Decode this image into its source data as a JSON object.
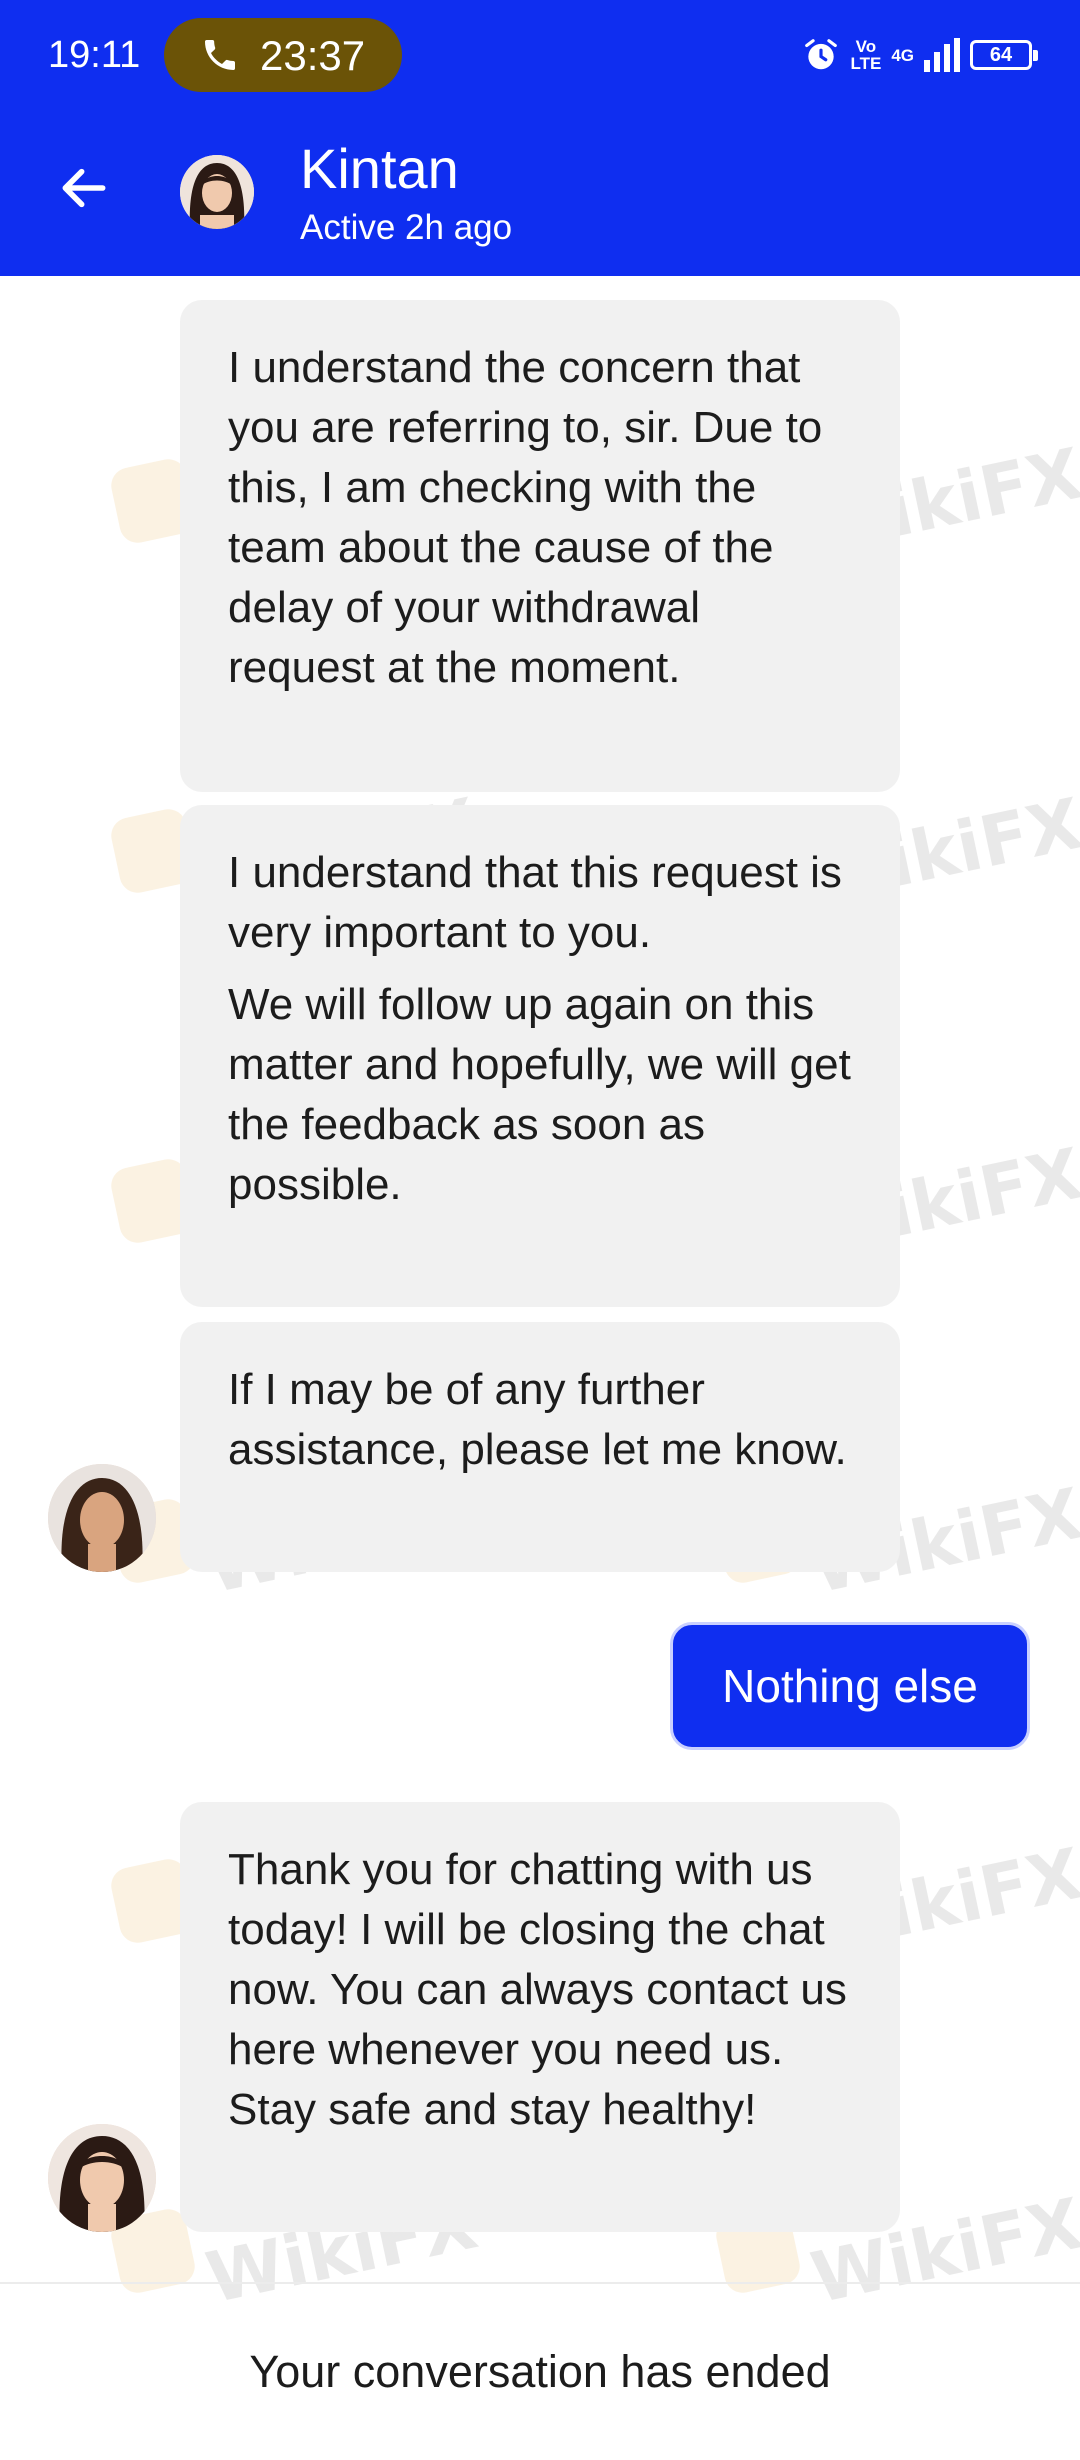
{
  "status_bar": {
    "time": "19:11",
    "call_duration": "23:37",
    "network_volte": "Vo\nLTE",
    "network_type": "4G",
    "battery_level": "64"
  },
  "header": {
    "contact_name": "Kintan",
    "contact_status": "Active 2h ago"
  },
  "messages": [
    {
      "from": "agent",
      "paragraphs": [
        "I understand the concern that you are referring to, sir. Due to this, I am checking with the team about the cause of the delay of your withdrawal request at the moment."
      ]
    },
    {
      "from": "agent",
      "paragraphs": [
        "I understand that this request is very important to you.",
        "We will follow up again on this matter and hopefully, we will get the feedback as soon as possible."
      ]
    },
    {
      "from": "agent",
      "paragraphs": [
        "If I may be of any further assistance, please let me know."
      ]
    },
    {
      "from": "user",
      "paragraphs": [
        "Nothing else"
      ]
    },
    {
      "from": "agent",
      "paragraphs": [
        "Thank you for chatting with us today! I will be closing the chat now. You can always contact us here whenever you need us. Stay safe and stay healthy!"
      ]
    }
  ],
  "footer": {
    "conversation_ended": "Your conversation has ended"
  },
  "watermark": "WikiFX",
  "colors": {
    "brand_blue": "#0f2ef0",
    "bubble_gray": "#f1f1f1",
    "call_pill": "#6b5307"
  }
}
